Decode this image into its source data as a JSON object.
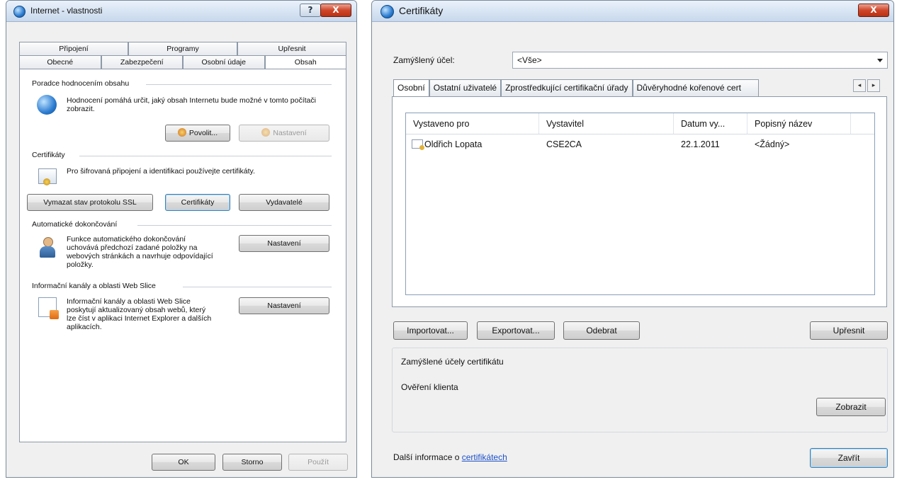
{
  "win1": {
    "title": "Internet - vlastnosti",
    "help_label": "?",
    "close_label": "X",
    "tabs_top": [
      "Připojení",
      "Programy",
      "Upřesnit"
    ],
    "tabs_bottom": [
      "Obecné",
      "Zabezpečení",
      "Osobní údaje",
      "Obsah"
    ],
    "content_advisor": {
      "title": "Poradce hodnocením obsahu",
      "desc": "Hodnocení pomáhá určit, jaký obsah Internetu bude možné v tomto počítači zobrazit.",
      "enable_label": "Povolit...",
      "settings_label": "Nastavení"
    },
    "certificates": {
      "title": "Certifikáty",
      "desc": "Pro šifrovaná připojení a identifikaci používejte certifikáty.",
      "clear_ssl_label": "Vymazat stav protokolu SSL",
      "certs_label": "Certifikáty",
      "publishers_label": "Vydavatelé"
    },
    "autocomplete": {
      "title": "Automatické dokončování",
      "desc": "Funkce automatického dokončování uchovává předchozí zadané položky na webových stránkách a navrhuje odpovídající položky.",
      "settings_label": "Nastavení"
    },
    "feeds": {
      "title": "Informační kanály a oblasti Web Slice",
      "desc": "Informační kanály a oblasti Web Slice poskytují aktualizovaný obsah webů, který lze číst v aplikaci Internet Explorer a dalších aplikacích.",
      "settings_label": "Nastavení"
    },
    "ok_label": "OK",
    "cancel_label": "Storno",
    "apply_label": "Použít"
  },
  "win2": {
    "title": "Certifikáty",
    "close_label": "X",
    "purpose_label": "Zamýšlený účel:",
    "purpose_value": "<Vše>",
    "tabs": [
      "Osobní",
      "Ostatní uživatelé",
      "Zprostředkující certifikační úřady",
      "Důvěryhodné kořenové cert"
    ],
    "scroll_left": "◂",
    "scroll_right": "▸",
    "columns": [
      "Vystaveno pro",
      "Vystavitel",
      "Datum vy...",
      "Popisný název"
    ],
    "rows": [
      {
        "issued_to": "Oldřich Lopata",
        "issuer": "CSE2CA",
        "date": "22.1.2011",
        "friendly": "<Žádný>"
      }
    ],
    "import_label": "Importovat...",
    "export_label": "Exportovat...",
    "remove_label": "Odebrat",
    "advanced_label": "Upřesnit",
    "purposes_title": "Zamýšlené účely certifikátu",
    "purposes_value": "Ověření klienta",
    "view_label": "Zobrazit",
    "more_info_text": "Další informace o",
    "more_info_link": "certifikátech",
    "close_button_label": "Zavřít"
  }
}
